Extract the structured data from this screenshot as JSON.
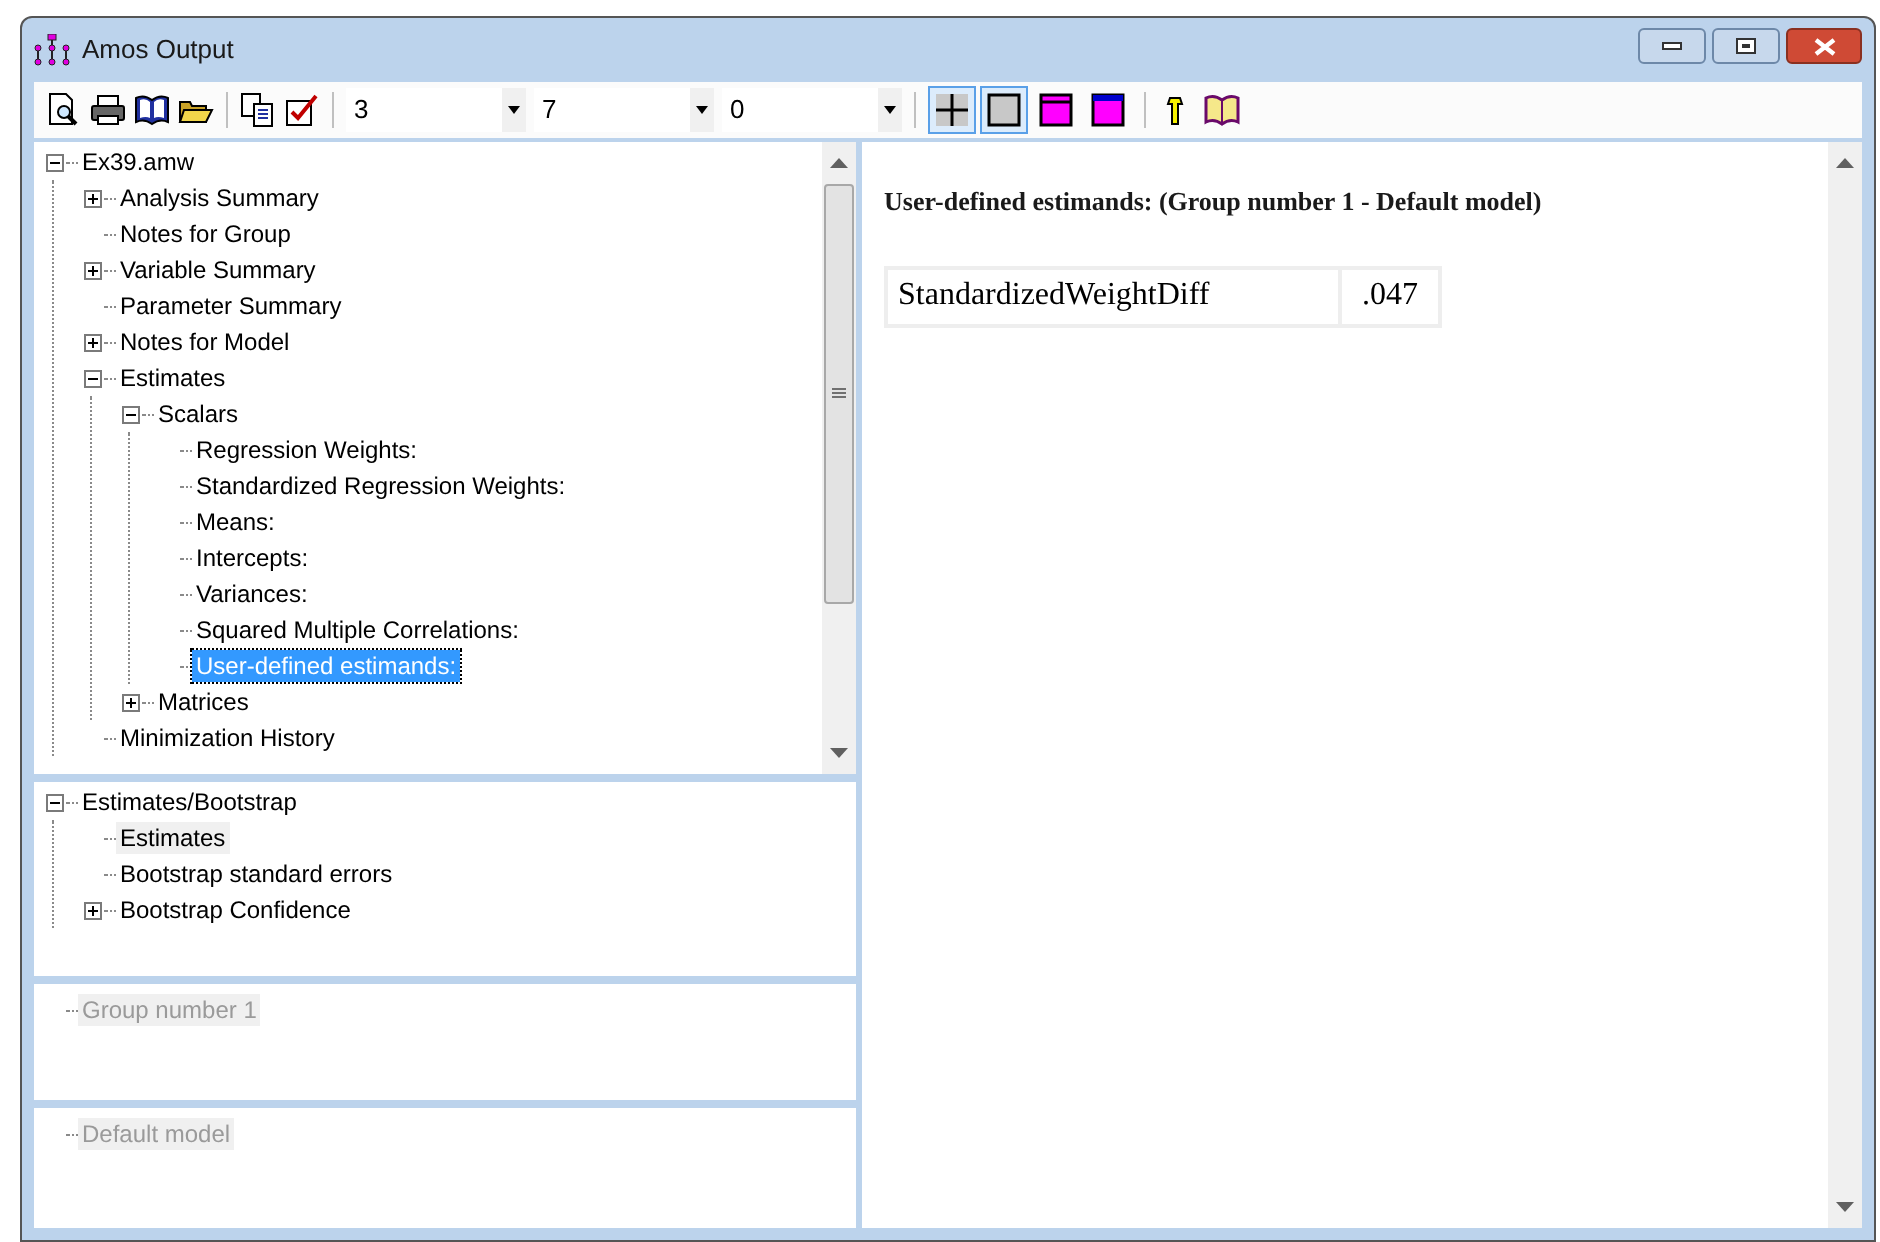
{
  "window": {
    "title": "Amos Output"
  },
  "toolbar": {
    "combos": [
      {
        "value": "3"
      },
      {
        "value": "7"
      },
      {
        "value": "0"
      }
    ],
    "toggles": [
      {
        "kind": "grid",
        "selected": true
      },
      {
        "kind": "frame",
        "selected": true
      },
      {
        "kind": "header",
        "selected": false
      },
      {
        "kind": "header-blue",
        "selected": false
      }
    ]
  },
  "output_tree": [
    {
      "label": "Ex39.amw",
      "expanded": true,
      "selected": false,
      "children": [
        {
          "label": "Analysis Summary",
          "expanded": false,
          "selected": false
        },
        {
          "label": "Notes for Group",
          "selected": false
        },
        {
          "label": "Variable Summary",
          "expanded": false,
          "selected": false
        },
        {
          "label": "Parameter Summary",
          "selected": false
        },
        {
          "label": "Notes for Model",
          "expanded": false,
          "selected": false
        },
        {
          "label": "Estimates",
          "expanded": true,
          "selected": false,
          "children": [
            {
              "label": "Scalars",
              "expanded": true,
              "selected": false,
              "children": [
                {
                  "label": "Regression Weights:",
                  "selected": false
                },
                {
                  "label": "Standardized Regression Weights:",
                  "selected": false
                },
                {
                  "label": "Means:",
                  "selected": false
                },
                {
                  "label": "Intercepts:",
                  "selected": false
                },
                {
                  "label": "Variances:",
                  "selected": false
                },
                {
                  "label": "Squared Multiple Correlations:",
                  "selected": false
                },
                {
                  "label": "User-defined estimands:",
                  "selected": true
                }
              ]
            },
            {
              "label": "Matrices",
              "expanded": false,
              "selected": false
            }
          ]
        },
        {
          "label": "Minimization History",
          "selected": false
        }
      ]
    }
  ],
  "bootstrap_tree": [
    {
      "label": "Estimates/Bootstrap",
      "expanded": true,
      "selected": false,
      "children": [
        {
          "label": "Estimates",
          "selected": true
        },
        {
          "label": "Bootstrap standard errors",
          "selected": false
        },
        {
          "label": "Bootstrap Confidence",
          "expanded": false,
          "selected": false
        }
      ]
    }
  ],
  "group_list": [
    {
      "label": "Group number 1",
      "selected": true,
      "disabled": true
    }
  ],
  "model_list": [
    {
      "label": "Default model",
      "selected": true,
      "disabled": true
    }
  ],
  "output": {
    "heading": "User-defined estimands: (Group number 1 - Default model)",
    "table": {
      "rows": [
        [
          "StandardizedWeightDiff",
          ".047"
        ]
      ]
    }
  }
}
